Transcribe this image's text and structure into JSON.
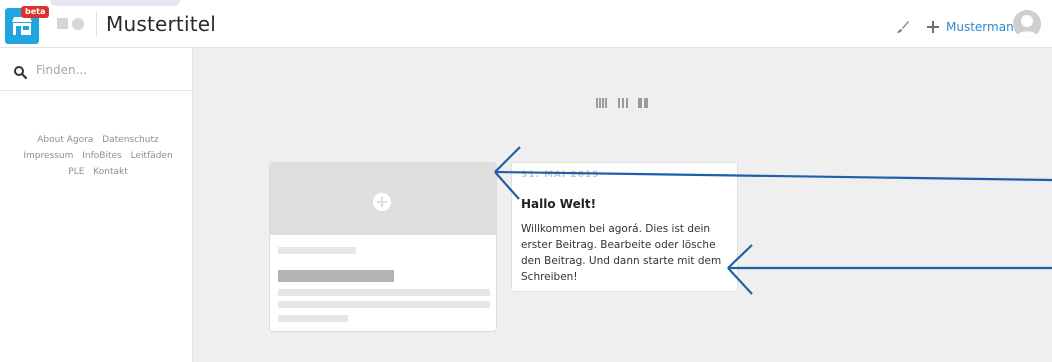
{
  "header": {
    "beta_badge": "beta",
    "title": "Mustertitel",
    "username": "Mustermann",
    "icons": [
      "store-logo-icon",
      "brush-icon",
      "plus-icon",
      "avatar-icon"
    ],
    "accent": "#2a8bd0",
    "logo_color": "#1fa5e0",
    "badge_color": "#d9342b"
  },
  "sidebar": {
    "search_placeholder": "Finden...",
    "footer_links": [
      "About Agora",
      "Datenschutz",
      "Impressum",
      "InfoBites",
      "Leitfäden",
      "PLE",
      "Kontakt"
    ]
  },
  "main": {
    "layout_toggle_icons": [
      "four-column-icon",
      "three-column-icon",
      "two-column-icon"
    ],
    "post": {
      "date": "31. MAI 2019",
      "title": "Hallo Welt!",
      "excerpt": "Willkommen bei agorá. Dies ist dein erster Beitrag. Bearbeite oder lösche den Beitrag. Und dann starte mit dem Schreiben!"
    }
  },
  "annotation_color": "#1f5fa8"
}
